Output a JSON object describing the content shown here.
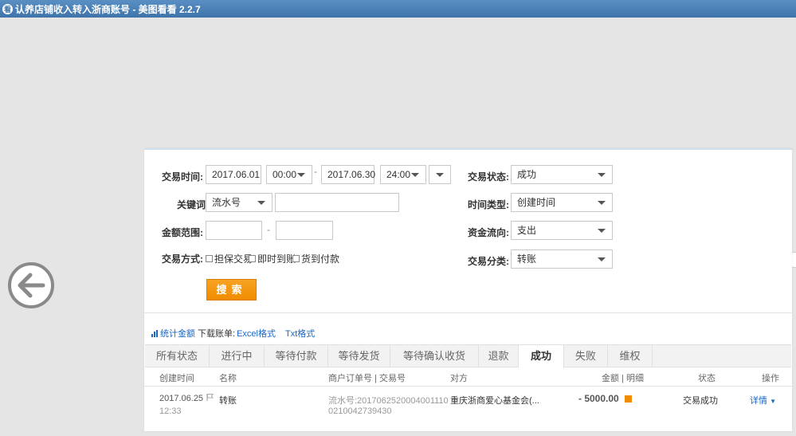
{
  "window": {
    "title": "认养店铺收入转入浙商账号 - 美图看看 2.2.7",
    "app_icon_char": "看"
  },
  "colors": {
    "accent_orange": "#f08c00",
    "link_blue": "#1a66c2",
    "titlebar": "#3f74aa"
  },
  "icons": {
    "back": "arrow-left-circle",
    "flag": "flag",
    "detail": "orange-square"
  },
  "filters": {
    "trade_time": {
      "label": "交易时间:",
      "start_date": "2017.06.01",
      "start_time": "00:00",
      "separator": "-",
      "end_date": "2017.06.30",
      "end_time": "24:00"
    },
    "keyword": {
      "label": "关键词:",
      "type_value": "流水号",
      "value": ""
    },
    "amount_range": {
      "label": "金额范围:",
      "min": "",
      "separator": "-",
      "max": ""
    },
    "trade_method": {
      "label": "交易方式:",
      "options": [
        "担保交易",
        "即时到账",
        "货到付款"
      ]
    },
    "trade_status": {
      "label": "交易状态:",
      "value": "成功"
    },
    "time_type": {
      "label": "时间类型:",
      "value": "创建时间"
    },
    "fund_flow": {
      "label": "资金流向:",
      "value": "支出"
    },
    "trade_category": {
      "label": "交易分类:",
      "value": "转账"
    },
    "search_button": "搜索"
  },
  "stats": {
    "stat_link": "统计金额",
    "download_label": "下载账单:",
    "excel_link": "Excel格式",
    "txt_link": "Txt格式"
  },
  "tabs": [
    "所有状态",
    "进行中",
    "等待付款",
    "等待发货",
    "等待确认收货",
    "退款",
    "成功",
    "失败",
    "维权"
  ],
  "active_tab": "成功",
  "table": {
    "headers": {
      "created": "创建时间",
      "name": "名称",
      "order_no": "商户订单号 | 交易号",
      "counterparty": "对方",
      "amount": "金额 | 明细",
      "status": "状态",
      "action": "操作"
    },
    "rows": [
      {
        "date": "2017.06.25",
        "time": "12:33",
        "name": "转账",
        "serial_line1": "流水号:2017062520004001110",
        "serial_line2": "0210042739430",
        "counterparty": "重庆浙商爱心基金会(...",
        "amount": "- 5000.00",
        "status": "交易成功",
        "action": "详情"
      }
    ]
  }
}
